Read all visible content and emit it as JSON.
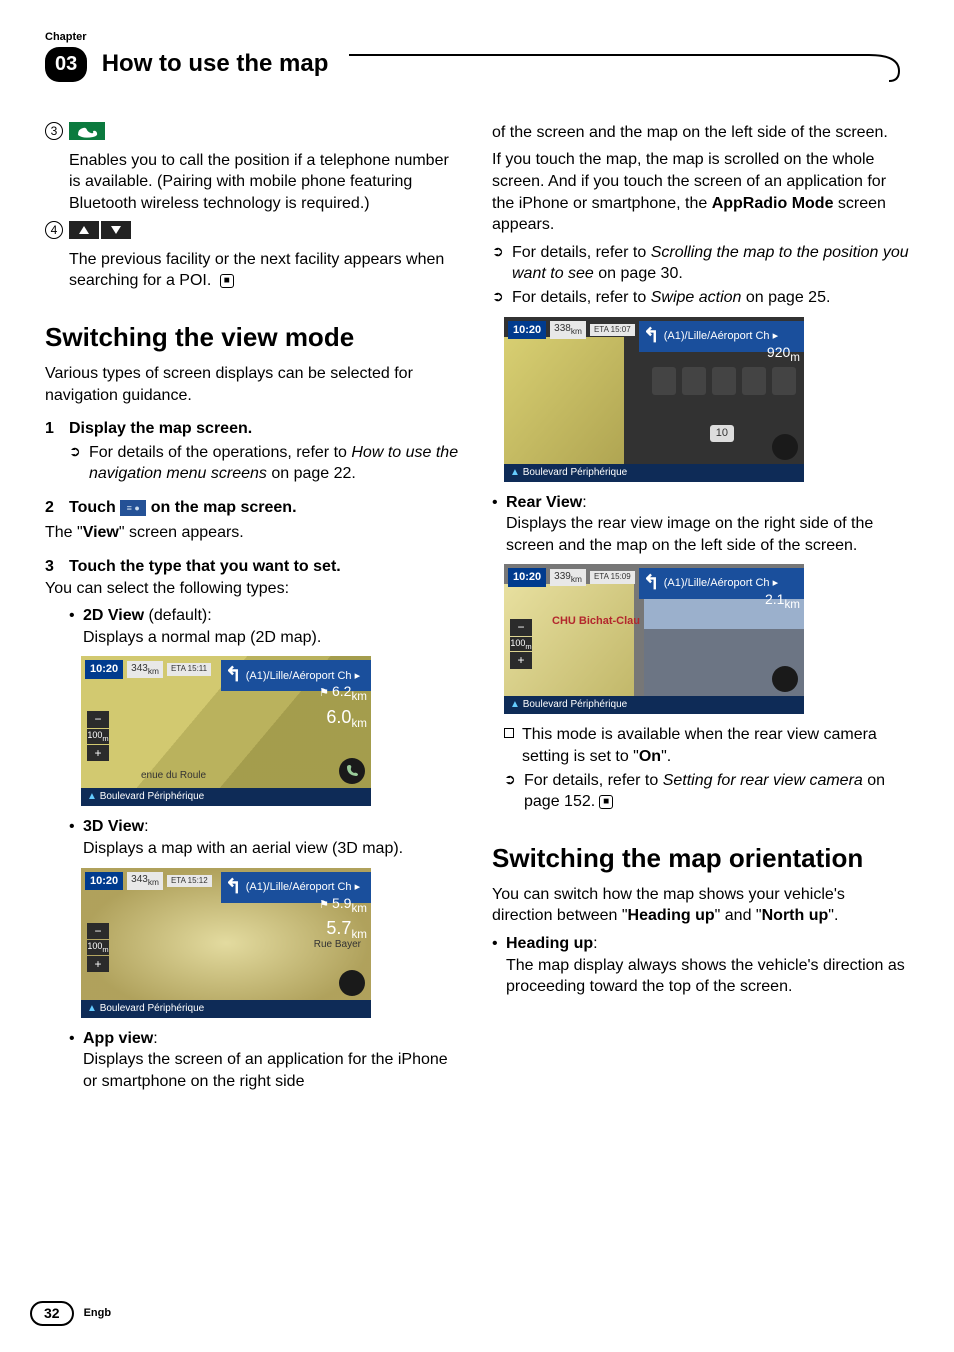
{
  "header": {
    "chapter_label": "Chapter",
    "chapter_num": "03",
    "title": "How to use the map"
  },
  "col1": {
    "item3_num": "3",
    "item3_text": "Enables you to call the position if a telephone number is available. (Pairing with mobile phone featuring Bluetooth wireless technology is required.)",
    "item4_num": "4",
    "item4_text": "The previous facility or the next facility appears when searching for a POI.",
    "stop_icon": "■",
    "sect1": "Switching the view mode",
    "sect1_intro": "Various types of screen displays can be selected for navigation guidance.",
    "step1_n": "1",
    "step1": "Display the map screen.",
    "step1_ref": "For details of the operations, refer to ",
    "step1_ref_em": "How to use the navigation menu screens",
    "step1_ref_tail": " on page 22.",
    "step2_n": "2",
    "step2_a": "Touch ",
    "step2_b": " on the map screen.",
    "step2_result_a": "The \"",
    "step2_result_b": "View",
    "step2_result_c": "\" screen appears.",
    "step3_n": "3",
    "step3": "Touch the type that you want to set.",
    "step3_intro": "You can select the following types:",
    "t2d_label": "2D View",
    "t2d_suffix": " (default):",
    "t2d_desc": "Displays a normal map (2D map).",
    "map1_time": "10:20",
    "map1_dist": "343",
    "map1_unit": "km",
    "map1_eta": "ETA 15:11",
    "map1_route": "(A1)/Lille/Aéroport Ch ▸",
    "map1_d1": "6.2",
    "map1_d2": "6.0",
    "map1_km": "km",
    "map1_zoom": "100",
    "map1_zu": "m",
    "map1_street": "enue du Roule",
    "map1_bar": "Boulevard Périphérique",
    "t3d_label": "3D View",
    "t3d_colon": ":",
    "t3d_desc": "Displays a map with an aerial view (3D map).",
    "map2_time": "10:20",
    "map2_dist": "343",
    "map2_eta": "ETA 15:12",
    "map2_route": "(A1)/Lille/Aéroport Ch ▸",
    "map2_d1": "5.9",
    "map2_d2": "5.7",
    "map2_street": "Rue Bayer",
    "map2_bar": "Boulevard Périphérique",
    "tapp_label": "App view",
    "tapp_colon": ":",
    "tapp_desc": "Displays the screen of an application for the iPhone or smartphone on the right side"
  },
  "col2": {
    "cont1": "of the screen and the map on the left side of the screen.",
    "cont2a": "If you touch the map, the map is scrolled on the whole screen. And if you touch the screen of an application for the iPhone or smartphone, the ",
    "cont2b": "AppRadio Mode",
    "cont2c": " screen appears.",
    "ref1a": "For details, refer to ",
    "ref1b": "Scrolling the map to the position you want to see",
    "ref1c": " on page 30.",
    "ref2a": "For details, refer to ",
    "ref2b": "Swipe action",
    "ref2c": " on page 25.",
    "map3_time": "10:20",
    "map3_dist": "338",
    "map3_eta": "ETA 15:07",
    "map3_route": "(A1)/Lille/Aéroport Ch ▸",
    "map3_d": "920",
    "map3_u": "m",
    "map3_sp": "10",
    "map3_bar": "Boulevard Périphérique",
    "trear_label": "Rear View",
    "trear_colon": ":",
    "trear_desc": "Displays the rear view image on the right side of the screen and the map on the left side of the screen.",
    "map4_time": "10:20",
    "map4_dist": "339",
    "map4_eta": "ETA 15:09",
    "map4_route": "(A1)/Lille/Aéroport Ch ▸",
    "map4_d": "2.1",
    "map4_u": "km",
    "map4_chu": "CHU Bichat-Clau",
    "map4_bar": "Boulevard Périphérique",
    "note1a": "This mode is available when the rear view camera setting is set to \"",
    "note1b": "On",
    "note1c": "\".",
    "ref3a": "For details, refer to ",
    "ref3b": "Setting for rear view camera",
    "ref3c": " on page 152.",
    "sect2": "Switching the map orientation",
    "sect2_a": "You can switch how the map shows your vehicle's direction between \"",
    "sect2_b": "Heading up",
    "sect2_c": "\" and \"",
    "sect2_d": "North up",
    "sect2_e": "\".",
    "heading_label": "Heading up",
    "heading_colon": ":",
    "heading_desc": "The map display always shows the vehicle's direction as proceeding toward the top of the screen."
  },
  "footer": {
    "page": "32",
    "lang": "Engb"
  }
}
